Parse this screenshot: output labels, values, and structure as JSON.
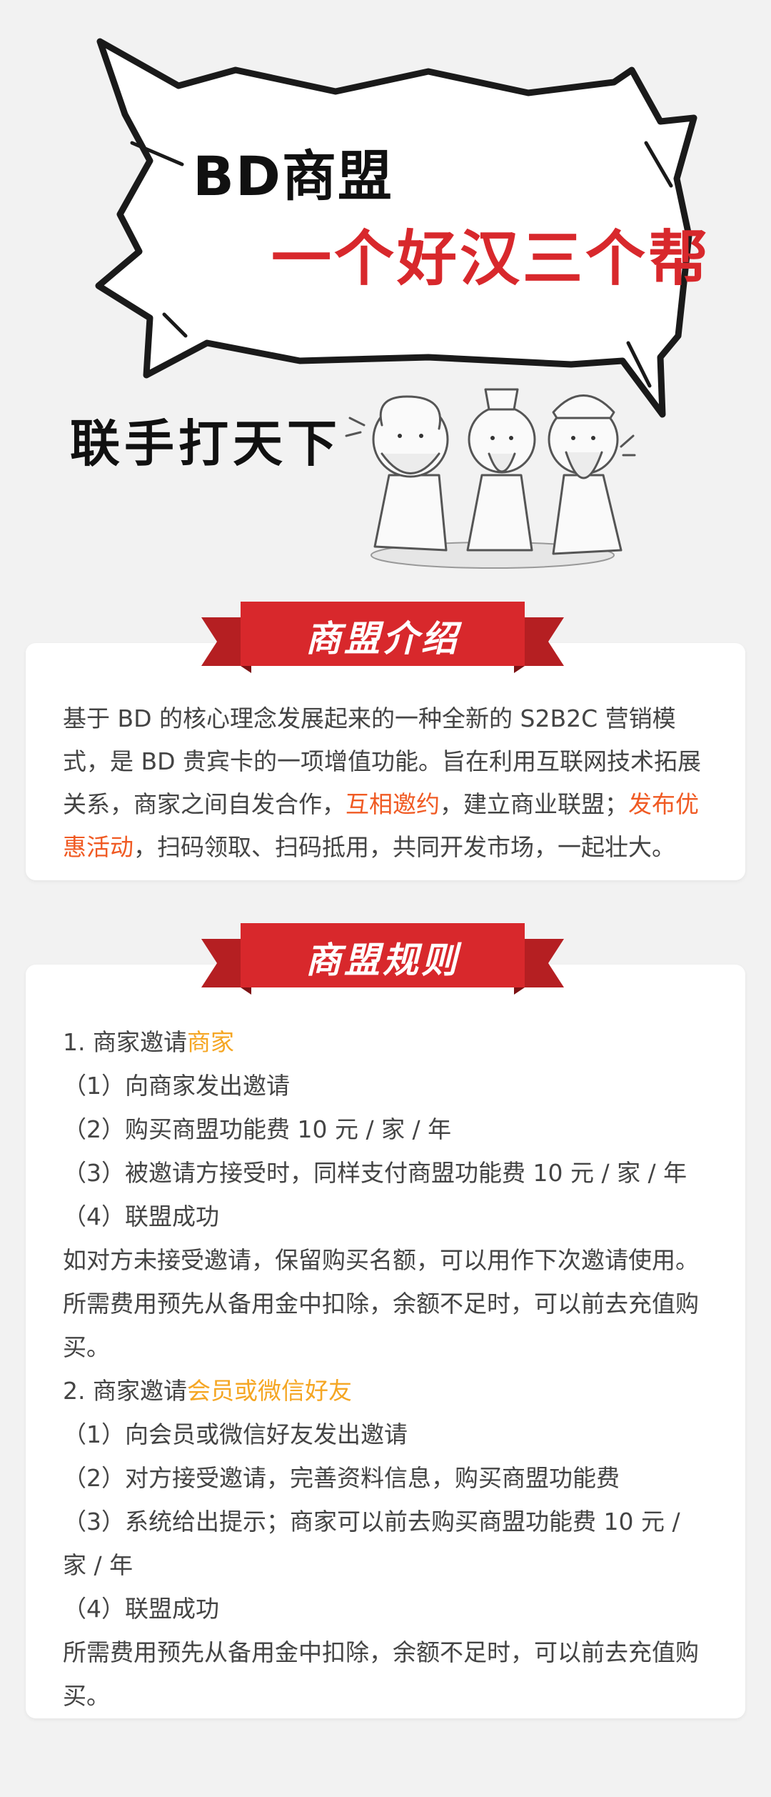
{
  "hero": {
    "title": "BD商盟",
    "slogan": "一个好汉三个帮",
    "side_text": "联手打天下"
  },
  "intro_section": {
    "heading": "商盟介绍",
    "text_1": "基于 BD 的核心理念发展起来的一种全新的 S2B2C 营销模式，是 BD 贵宾卡的一项增值功能。旨在利用互联网技术拓展关系，商家之间自发合作，",
    "highlight_1": "互相邀约",
    "text_2": "，建立商业联盟；",
    "highlight_2": "发布优惠活动",
    "text_3": "，扫码领取、扫码抵用，共同开发市场，一起壮大。"
  },
  "rules_section": {
    "heading": "商盟规则",
    "rule1_prefix": "1. 商家邀请",
    "rule1_highlight": "商家",
    "rule1_steps": [
      "（1）向商家发出邀请",
      "（2）购买商盟功能费 10 元 / 家 / 年",
      "（3）被邀请方接受时，同样支付商盟功能费 10 元 / 家 / 年",
      "（4）联盟成功"
    ],
    "rule1_note_1": "如对方未接受邀请，保留购买名额，可以用作下次邀请使用。",
    "rule1_note_2": "所需费用预先从备用金中扣除，余额不足时，可以前去充值购买。",
    "rule2_prefix": "2. 商家邀请",
    "rule2_highlight": "会员或微信好友",
    "rule2_steps": [
      "（1）向会员或微信好友发出邀请",
      "（2）对方接受邀请，完善资料信息，购买商盟功能费",
      "（3）系统给出提示；商家可以前去购买商盟功能费 10 元 / 家 / 年",
      "（4）联盟成功"
    ],
    "rule2_note": "所需费用预先从备用金中扣除，余额不足时，可以前去充值购买。"
  },
  "colors": {
    "background": "#f2f2f2",
    "brand_red": "#d8282c",
    "highlight_red": "#f05a23",
    "highlight_orange": "#f5a623",
    "text": "#444444"
  }
}
